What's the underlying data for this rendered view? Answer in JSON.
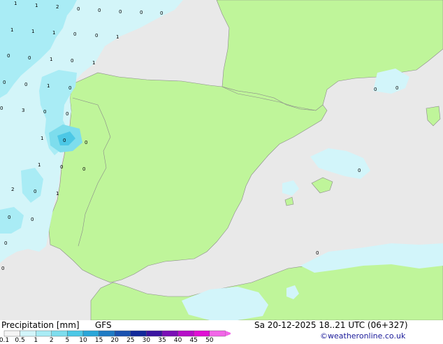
{
  "legend": {
    "title": "Precipitation [mm]",
    "model": "GFS",
    "run": "Sa 20-12-2025 18..21 UTC (06+327)",
    "credit": "©weatheronline.co.uk",
    "ticks": [
      "0.1",
      "0.5",
      "1",
      "2",
      "5",
      "10",
      "15",
      "20",
      "25",
      "30",
      "35",
      "40",
      "45",
      "50"
    ],
    "colors": [
      "#f5f5f5",
      "#d2f5fa",
      "#a9ecf5",
      "#7ddded",
      "#4cc8e6",
      "#2aa6d8",
      "#1f7bc4",
      "#1a52b0",
      "#12299a",
      "#3a14a0",
      "#7a0fb6",
      "#b60ec8",
      "#e00fd4",
      "#f266e8"
    ]
  },
  "map": {
    "land_color": "#bff59a",
    "sea_color": "#e9e9e9",
    "border_color": "#7a7a7a",
    "labels": [
      {
        "text": "1"
      },
      {
        "text": "1"
      },
      {
        "text": "2"
      },
      {
        "text": "0"
      },
      {
        "text": "0"
      },
      {
        "text": "0"
      },
      {
        "text": "0"
      },
      {
        "text": "0"
      },
      {
        "text": "1"
      },
      {
        "text": "1"
      },
      {
        "text": "1"
      },
      {
        "text": "0"
      },
      {
        "text": "0"
      },
      {
        "text": "1"
      },
      {
        "text": "0"
      },
      {
        "text": "0"
      },
      {
        "text": "1"
      },
      {
        "text": "0"
      },
      {
        "text": "1"
      },
      {
        "text": "0"
      },
      {
        "text": "0"
      },
      {
        "text": "1"
      },
      {
        "text": "0"
      },
      {
        "text": "0"
      },
      {
        "text": "3"
      },
      {
        "text": "0"
      },
      {
        "text": "0"
      },
      {
        "text": "1"
      },
      {
        "text": "0"
      },
      {
        "text": "0"
      },
      {
        "text": "1"
      },
      {
        "text": "0"
      },
      {
        "text": "0"
      },
      {
        "text": "2"
      },
      {
        "text": "0"
      },
      {
        "text": "1"
      },
      {
        "text": "0"
      },
      {
        "text": "0"
      },
      {
        "text": "0"
      },
      {
        "text": "0"
      },
      {
        "text": "0"
      },
      {
        "text": "0"
      },
      {
        "text": "0"
      },
      {
        "text": "0"
      }
    ]
  }
}
